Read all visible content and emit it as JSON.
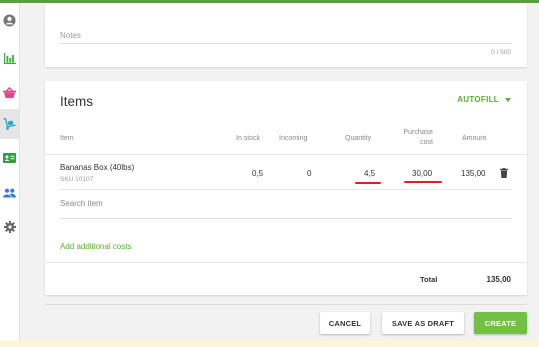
{
  "colors": {
    "accent_green": "#5cae2e",
    "create_button": "#72c045",
    "annotation_red": "#e02020",
    "sidebar_icons": [
      "#777777",
      "#3cae3c",
      "#e04a8a",
      "#2aa5c9",
      "#2f9f3f",
      "#2f7fd0",
      "#666666"
    ]
  },
  "sidebar": {
    "items": [
      {
        "icon": "user-circle-icon"
      },
      {
        "icon": "bar-chart-icon"
      },
      {
        "icon": "basket-icon"
      },
      {
        "icon": "dolly-icon",
        "active": true
      },
      {
        "icon": "id-card-icon"
      },
      {
        "icon": "users-icon"
      },
      {
        "icon": "gear-icon"
      }
    ]
  },
  "notes": {
    "label": "Notes",
    "counter": "0 / 500"
  },
  "items": {
    "title": "Items",
    "autofill_label": "AUTOFILL",
    "columns": {
      "item": "Item",
      "in_stock": "In stock",
      "incoming": "Incoming",
      "quantity": "Quantity",
      "purchase_cost_line1": "Purchase",
      "purchase_cost_line2": "cost",
      "amount": "Amount"
    },
    "rows": [
      {
        "name": "Bananas Box (40lbs)",
        "sku": "SKU 10107",
        "in_stock": "0,5",
        "incoming": "0",
        "quantity": "4,5",
        "purchase_cost": "30,00",
        "amount": "135,00"
      }
    ],
    "search_placeholder": "Search item",
    "add_costs_label": "Add additional costs",
    "total_label": "Total",
    "total_value": "135,00"
  },
  "footer": {
    "cancel_label": "CANCEL",
    "draft_label": "SAVE AS DRAFT",
    "create_label": "CREATE"
  }
}
